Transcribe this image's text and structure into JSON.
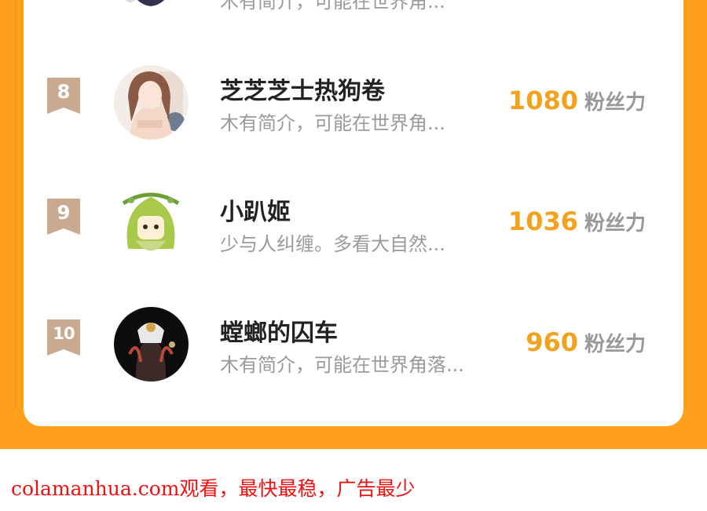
{
  "ranking": {
    "partial_row": {
      "desc": "木有简介，可能在世界角..."
    },
    "rows": [
      {
        "rank": "8",
        "name": "芝芝芝士热狗卷",
        "desc": "木有简介，可能在世界角...",
        "fans": "1080",
        "fans_label": "粉丝力",
        "avatar_icon": "avatar-girl-photo"
      },
      {
        "rank": "9",
        "name": "小趴姬",
        "desc": "少与人纠缠。多看大自然...",
        "fans": "1036",
        "fans_label": "粉丝力",
        "avatar_icon": "avatar-green-hair-chibi"
      },
      {
        "rank": "10",
        "name": "螳螂的囚车",
        "desc": "木有简介，可能在世界角落...",
        "fans": "960",
        "fans_label": "粉丝力",
        "avatar_icon": "avatar-dark-anime"
      }
    ]
  },
  "footer": {
    "text": "colamanhua.com观看，最快最稳，广告最少"
  },
  "colors": {
    "background": "#ff9f1c",
    "fans_number": "#f2a21c",
    "badge": "#c9a98f",
    "footer": "#ee1111"
  }
}
